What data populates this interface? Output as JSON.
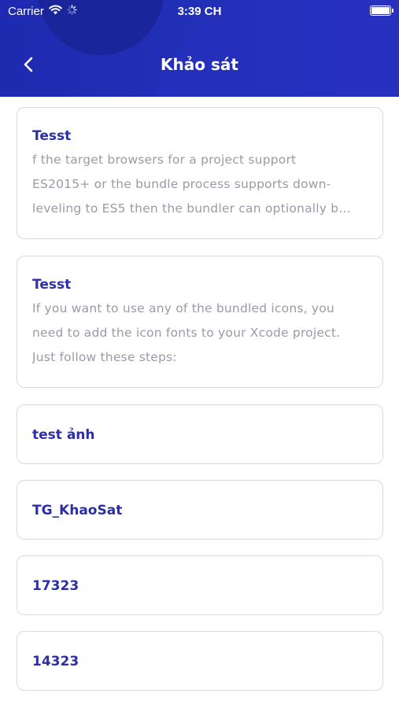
{
  "status_bar": {
    "carrier": "Carrier",
    "time": "3:39 CH"
  },
  "header": {
    "title": "Khảo sát",
    "accent_color": "#2230b8"
  },
  "surveys": [
    {
      "title": "Tesst",
      "description_lines": [
        "f the target browsers for a project support",
        "ES2015+ or the bundle process supports down-",
        "leveling to ES5 then the bundler can optionally b..."
      ]
    },
    {
      "title": "Tesst",
      "description_lines": [
        "If you want to use any of the bundled icons, you",
        "need to add the icon fonts to your Xcode project.",
        "Just follow these steps:"
      ]
    },
    {
      "title": "test ảnh"
    },
    {
      "title": "TG_KhaoSat"
    },
    {
      "title": "17323"
    },
    {
      "title": "14323"
    }
  ],
  "icons": {
    "back": "chevron-left-icon",
    "wifi": "wifi-icon",
    "activity": "loading-spinner-icon",
    "battery": "battery-icon"
  }
}
